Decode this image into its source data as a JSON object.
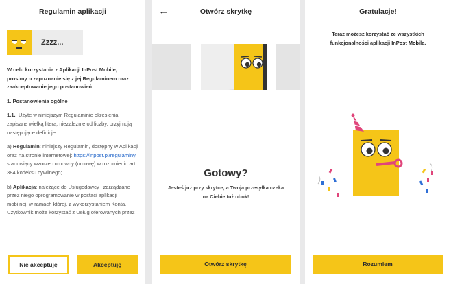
{
  "screen1": {
    "title": "Regulamin aplikacji",
    "sleep_text": "Zzzz...",
    "intro": "W celu korzystania z Aplikacji InPost Mobile, prosimy o zapoznanie się z jej Regulaminem oraz zaakceptowanie jego postanowień:",
    "section_title": "1. Postanowienia ogólne",
    "p1_num": "1.1.",
    "p1_text": "Użyte w niniejszym Regulaminie określenia zapisane wielką literą, niezależnie od liczby, przyjmują następujące definicje:",
    "a_prefix": "a)",
    "a_term": "Regulamin",
    "a_text_1": ": niniejszy Regulamin, dostępny w Aplikacji oraz na stronie internetowej:",
    "a_link": "https://inpost.pl/regulaminy",
    "a_text_2": ", stanowiący wzorzec umowny (umowę) w rozumieniu art. 384 kodeksu cywilnego;",
    "b_prefix": "b)",
    "b_term": "Aplikacja",
    "b_text": ": należące do Usługodawcy i zarządzane przez niego oprogramowanie w postaci aplikacji mobilnej, w ramach której, z wykorzystaniem Konta, Użytkownik może korzystać z Usług oferowanych przez",
    "decline_label": "Nie akceptuję",
    "accept_label": "Akceptuję"
  },
  "screen2": {
    "title": "Otwórz skrytkę",
    "back_icon": "←",
    "headline": "Gotowy?",
    "subtitle_line1": "Jesteś już przy skrytce, a Twoja przesyłka czeka",
    "subtitle_line2": "na Ciebie tuż obok!",
    "button_label": "Otwórz skrytkę"
  },
  "screen3": {
    "title": "Gratulacje!",
    "message_line1": "Teraz możesz korzystać ze wszystkich",
    "message_line2_prefix": "funkcjonalności aplikacji ",
    "message_brand": "InPost Mobile.",
    "button_label": "Rozumiem"
  },
  "colors": {
    "accent": "#f5c518",
    "link": "#1e63c8",
    "confetti_pink": "#e0457b",
    "confetti_blue": "#2f6fd6"
  }
}
